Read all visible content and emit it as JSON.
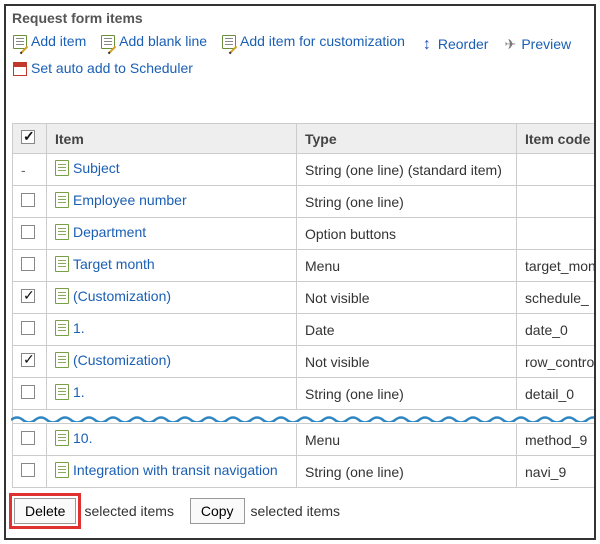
{
  "section_title": "Request form items",
  "toolbar": {
    "add_item": "Add item",
    "add_blank": "Add blank line",
    "add_custom": "Add item for customization",
    "reorder": "Reorder",
    "preview": "Preview",
    "auto_add": "Set auto add to Scheduler"
  },
  "table": {
    "headers": {
      "item": "Item",
      "type": "Type",
      "code": "Item code"
    },
    "rows": [
      {
        "check": "dash",
        "label": "Subject",
        "type": "String (one line) (standard item)",
        "code": ""
      },
      {
        "check": "unchecked",
        "label": "Employee number",
        "type": "String (one line)",
        "code": ""
      },
      {
        "check": "unchecked",
        "label": "Department",
        "type": "Option buttons",
        "code": ""
      },
      {
        "check": "unchecked",
        "label": "Target month",
        "type": "Menu",
        "code": "target_month"
      },
      {
        "check": "checked",
        "label": "(Customization)",
        "type": "Not visible",
        "code": "schedule_"
      },
      {
        "check": "unchecked",
        "label": "1.",
        "type": "Date",
        "code": "date_0"
      },
      {
        "check": "checked",
        "label": "(Customization)",
        "type": "Not visible",
        "code": "row_control"
      },
      {
        "check": "unchecked",
        "label": "1.",
        "type": "String (one line)",
        "code": "detail_0"
      }
    ],
    "rows_after": [
      {
        "check": "unchecked",
        "label": "10.",
        "type": "Menu",
        "code": "method_9"
      },
      {
        "check": "unchecked",
        "label": "Integration with transit navigation",
        "type": "String (one line)",
        "code": "navi_9"
      }
    ]
  },
  "footer": {
    "delete_btn": "Delete",
    "delete_suffix": "selected items",
    "copy_btn": "Copy",
    "copy_suffix": "selected items"
  }
}
